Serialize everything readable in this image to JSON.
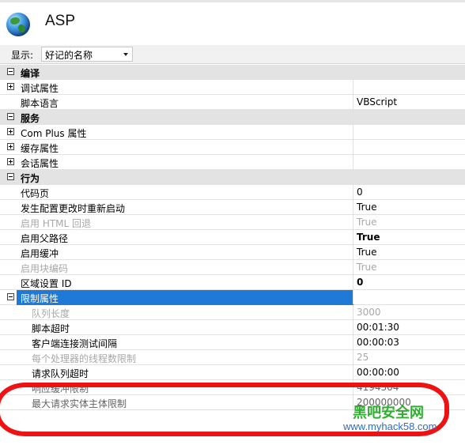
{
  "header": {
    "title": "ASP"
  },
  "toolbar": {
    "show_label": "显示:",
    "show_value": "好记的名称"
  },
  "rows": [
    {
      "type": "category",
      "expander": "minus",
      "name": "编译",
      "value": ""
    },
    {
      "type": "item",
      "expander": "plus",
      "name": "调试属性",
      "value": ""
    },
    {
      "type": "item",
      "name": "脚本语言",
      "value": "VBScript"
    },
    {
      "type": "category",
      "expander": "minus",
      "name": "服务",
      "value": ""
    },
    {
      "type": "item",
      "expander": "plus",
      "name": "Com Plus 属性",
      "value": ""
    },
    {
      "type": "item",
      "expander": "plus",
      "name": "缓存属性",
      "value": ""
    },
    {
      "type": "item",
      "expander": "plus",
      "name": "会话属性",
      "value": ""
    },
    {
      "type": "category",
      "expander": "minus",
      "name": "行为",
      "value": ""
    },
    {
      "type": "item",
      "name": "代码页",
      "value": "0"
    },
    {
      "type": "item",
      "name": "发生配置更改时重新启动",
      "value": "True"
    },
    {
      "type": "item",
      "state": "disabled",
      "name": "启用 HTML 回退",
      "value": "True"
    },
    {
      "type": "item",
      "state": "bold",
      "name": "启用父路径",
      "value": "True"
    },
    {
      "type": "item",
      "name": "启用缓冲",
      "value": "True"
    },
    {
      "type": "item",
      "state": "disabled",
      "name": "启用块编码",
      "value": "True"
    },
    {
      "type": "item",
      "state": "bold",
      "name": "区域设置 ID",
      "value": "0"
    },
    {
      "type": "item",
      "expander": "minus",
      "state": "selected",
      "name": "限制属性",
      "value": ""
    },
    {
      "type": "item",
      "indent": true,
      "state": "disabled",
      "name": "队列长度",
      "value": "3000"
    },
    {
      "type": "item",
      "indent": true,
      "name": "脚本超时",
      "value": "00:01:30"
    },
    {
      "type": "item",
      "indent": true,
      "name": "客户端连接测试间隔",
      "value": "00:00:03"
    },
    {
      "type": "item",
      "indent": true,
      "state": "disabled",
      "name": "每个处理器的线程数限制",
      "value": "25"
    },
    {
      "type": "item",
      "indent": true,
      "name": "请求队列超时",
      "value": "00:00:00"
    },
    {
      "type": "item",
      "indent": true,
      "state": "obscured",
      "name": "响应缓冲限制",
      "value": "4194304"
    },
    {
      "type": "item",
      "indent": true,
      "state": "obscured",
      "name": "最大请求实体主体限制",
      "value": "200000000"
    }
  ],
  "annotation": {
    "watermark_text": "黑吧安全网",
    "watermark_url": "www.myhack58.com",
    "circle_color": "#ef1212"
  }
}
